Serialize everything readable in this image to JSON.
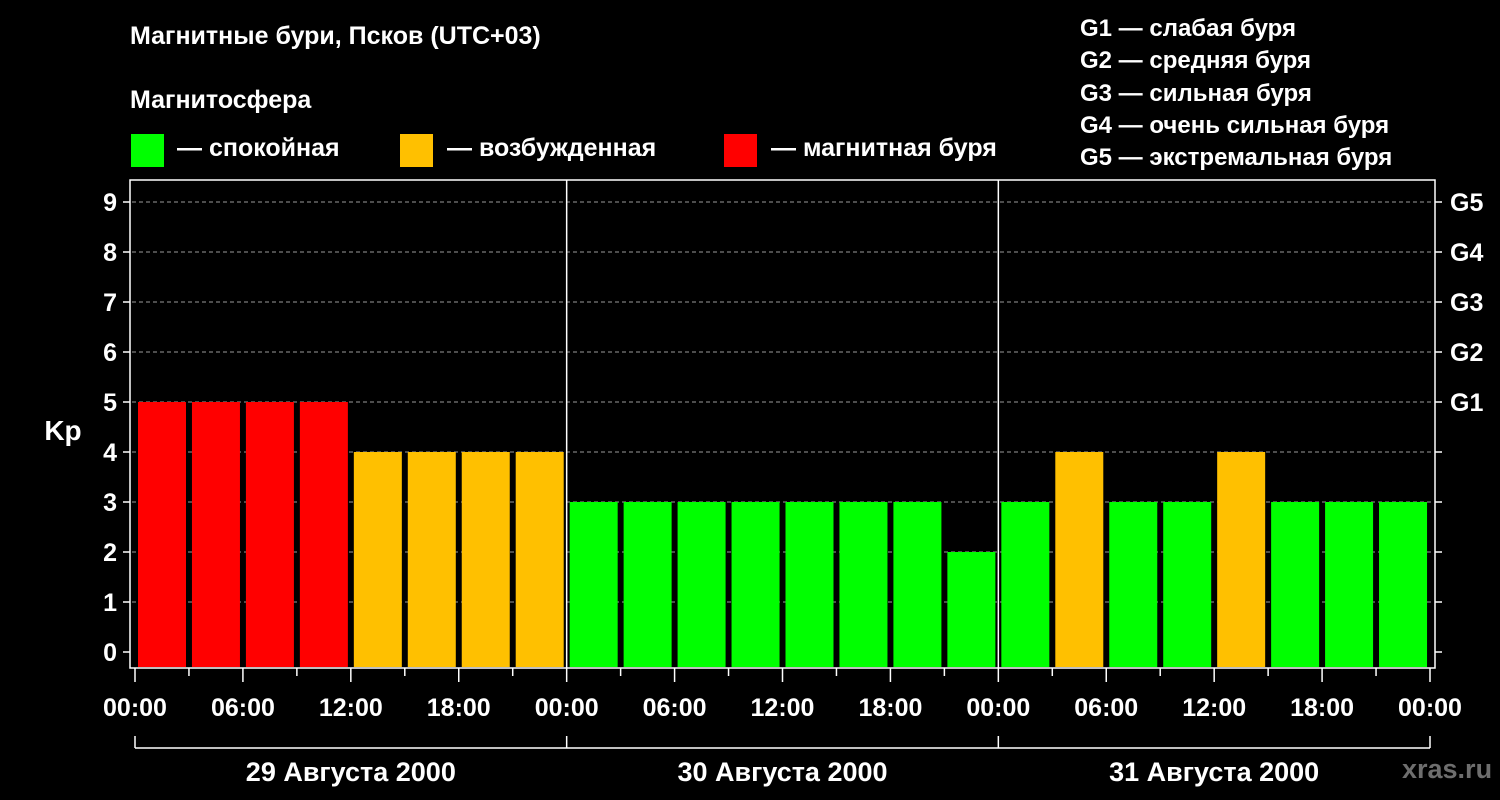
{
  "title": "Магнитные бури, Псков (UTC+03)",
  "subtitle": "Магнитосфера",
  "legend": {
    "calm": {
      "label": "— спокойная",
      "color": "#00ff00"
    },
    "excited": {
      "label": "— возбужденная",
      "color": "#ffc000"
    },
    "storm": {
      "label": "— магнитная буря",
      "color": "#ff0000"
    }
  },
  "g_legend": [
    "G1 — слабая буря",
    "G2 — средняя буря",
    "G3 — сильная буря",
    "G4 — очень сильная буря",
    "G5 — экстремальная буря"
  ],
  "watermark": "xras.ru",
  "chart_data": {
    "type": "bar",
    "ylabel": "Kp",
    "ylim": [
      0,
      9
    ],
    "y_ticks": [
      "0",
      "1",
      "2",
      "3",
      "4",
      "5",
      "6",
      "7",
      "8",
      "9"
    ],
    "right_axis_ticks": [
      {
        "value": 5,
        "label": "G1"
      },
      {
        "value": 6,
        "label": "G2"
      },
      {
        "value": 7,
        "label": "G3"
      },
      {
        "value": 8,
        "label": "G4"
      },
      {
        "value": 9,
        "label": "G5"
      }
    ],
    "grid": "horizontal dashed",
    "x_tick_labels": [
      "00:00",
      "06:00",
      "12:00",
      "18:00",
      "00:00",
      "06:00",
      "12:00",
      "18:00",
      "00:00",
      "06:00",
      "12:00",
      "18:00",
      "00:00"
    ],
    "days": [
      "29 Августа 2000",
      "30 Августа 2000",
      "31 Августа 2000"
    ],
    "interval_hours": 3,
    "values": [
      5,
      5,
      5,
      5,
      4,
      4,
      4,
      4,
      3,
      3,
      3,
      3,
      3,
      3,
      3,
      2,
      3,
      4,
      3,
      3,
      4,
      3,
      3,
      3
    ],
    "thresholds": {
      "excited_min": 4,
      "storm_min": 5
    }
  }
}
